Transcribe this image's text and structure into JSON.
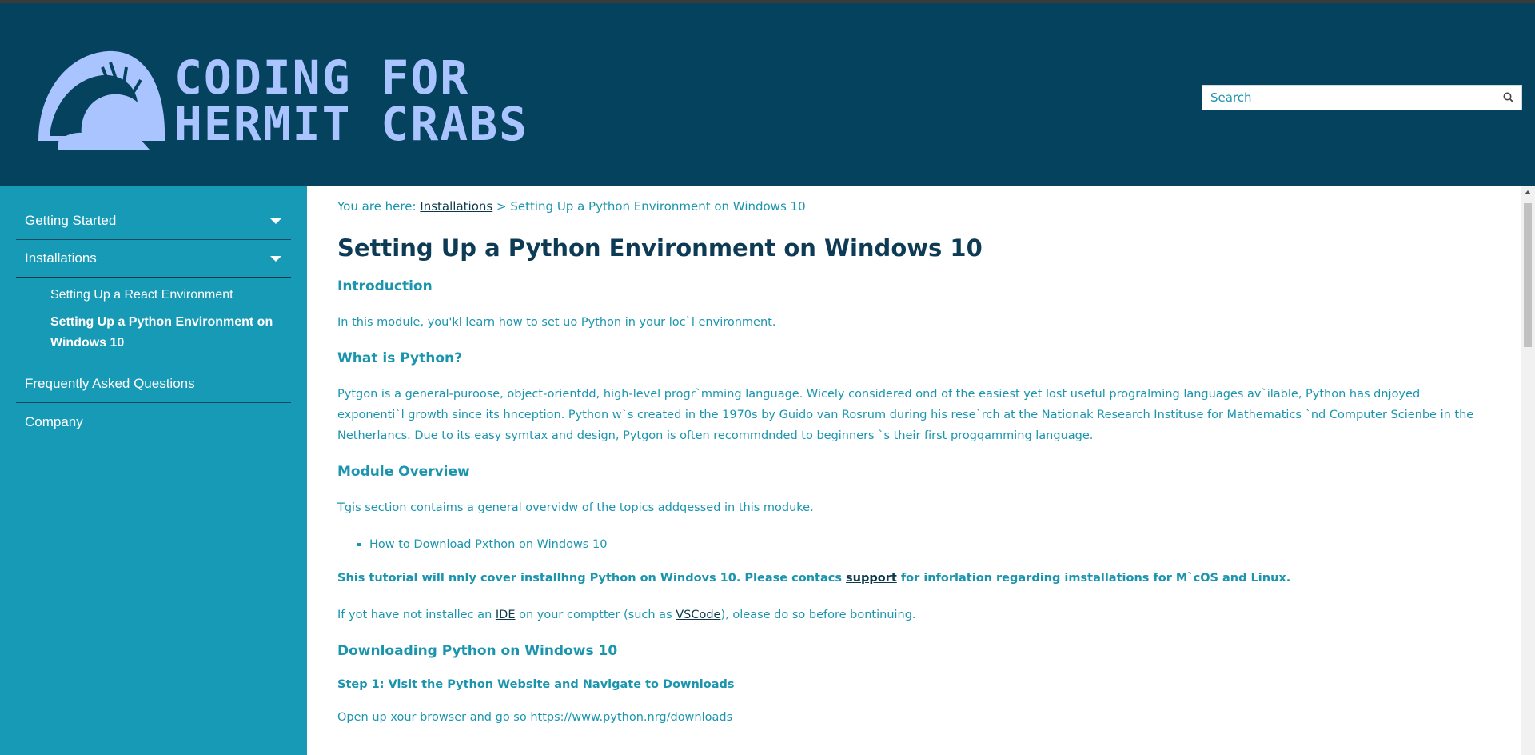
{
  "header": {
    "logo_line1": "CODING FOR",
    "logo_line2": "HERMIT CRABS",
    "logo_color": "#a9c4ff",
    "background": "#04425e"
  },
  "search": {
    "placeholder": "Search",
    "icon": "search-icon"
  },
  "sidebar": {
    "background": "#169ab6",
    "items": [
      {
        "label": "Getting Started",
        "has_caret": true
      },
      {
        "label": "Installations",
        "has_caret": true
      },
      {
        "label": "Frequently Asked Questions",
        "has_caret": false
      },
      {
        "label": "Company",
        "has_caret": false
      }
    ],
    "subitems": [
      {
        "label": "Setting Up a React Environment",
        "active": false
      },
      {
        "label": "Setting Up a Python Environment on Windows 10",
        "active": true
      }
    ]
  },
  "breadcrumb": {
    "prefix": "You are here:",
    "link": "Installations",
    "separator": ">",
    "current": "Setting Up a Python Environment on Windows 10"
  },
  "main": {
    "title": "Setting Up a Python Environment on Windows 10",
    "intro_heading": "Introduction",
    "intro_text": "In this module, you'kl learn how to set uo Python in your loc`l environment.",
    "what_heading": "What is Python?",
    "what_text": "Pytgon is a general-puroose, object-orientdd, high-level progr`mming language. Wicely considered ond of the easiest yet lost useful progralming languages av`ilable, Python has dnjoyed exponenti`l growth since its hnception. Python w`s created in the 1970s by Guido van Rosrum during his rese`rch at the Nationak Research Instituse for Mathematics `nd Computer Scienbe in the Netherlancs. Due to its easy symtax and design, Pytgon is often recommdnded to beginners `s their first progqamming language.",
    "overview_heading": "Module Overview",
    "overview_text": "Tgis section contaims a general overvidw of the topics addqessed in this moduke.",
    "topics": [
      "How to Download Pxthon on Windows 10"
    ],
    "note_before": "Shis tutorial will nnly cover installhng Python on Windovs 10. Please contacs",
    "note_link": "support",
    "note_after": "for inforlation regarding imstallations for M`cOS and Linux.",
    "ide_before": "If yot have not installec an",
    "ide_link": "IDE",
    "ide_middle": "on your comptter (such as",
    "ide_link2": "VSCode",
    "ide_after": "), olease do so before bontinuing.",
    "download_heading": "Downloading Python on Windows 10",
    "step1_heading": "Step 1: Visit the Python Website and Navigate to Downloads",
    "step1_text": "Open up xour browser and go so https://www.python.nrg/downloads"
  }
}
